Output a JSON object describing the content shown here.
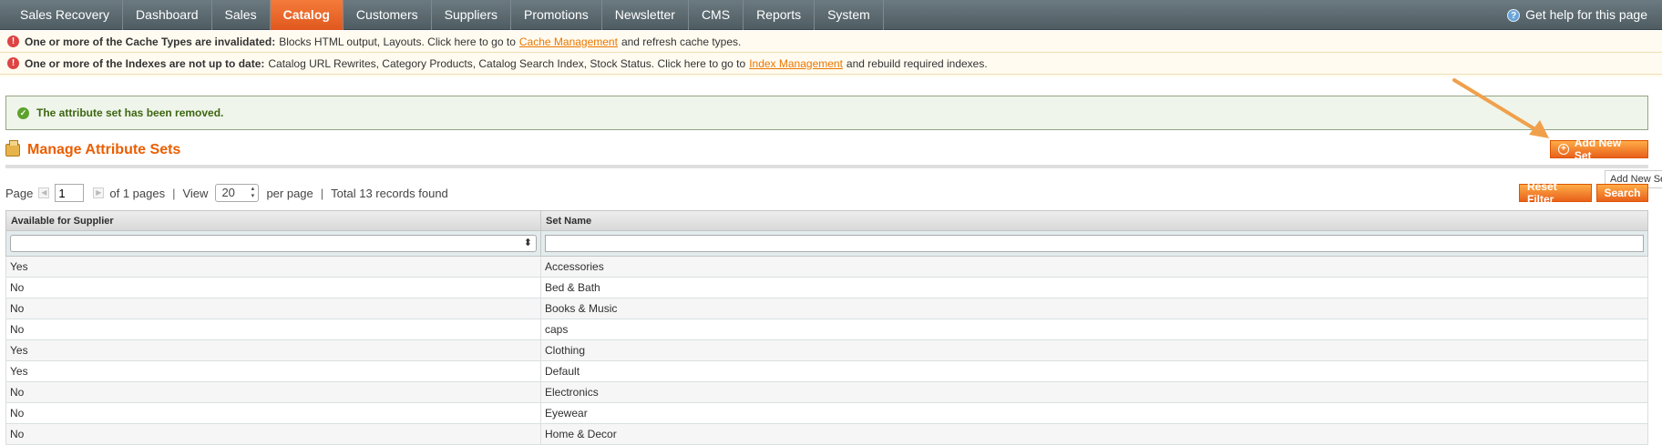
{
  "nav": {
    "items": [
      "Sales Recovery",
      "Dashboard",
      "Sales",
      "Catalog",
      "Customers",
      "Suppliers",
      "Promotions",
      "Newsletter",
      "CMS",
      "Reports",
      "System"
    ],
    "active": "Catalog",
    "help": "Get help for this page"
  },
  "notices": [
    {
      "bold": "One or more of the Cache Types are invalidated:",
      "text": "Blocks HTML output, Layouts. Click here to go to",
      "link": "Cache Management",
      "tail": "and refresh cache types."
    },
    {
      "bold": "One or more of the Indexes are not up to date:",
      "text": "Catalog URL Rewrites, Category Products, Catalog Search Index, Stock Status. Click here to go to",
      "link": "Index Management",
      "tail": "and rebuild required indexes."
    }
  ],
  "success": "The attribute set has been removed.",
  "page": {
    "title": "Manage Attribute Sets",
    "add_button": "Add New Set",
    "tooltip": "Add New Set",
    "reset_button": "Reset Filter",
    "search_button": "Search"
  },
  "pager": {
    "page_label": "Page",
    "page_value": "1",
    "of_pages": "of 1 pages",
    "view_label": "View",
    "per_page_value": "20",
    "per_page_label": "per page",
    "total": "Total 13 records found"
  },
  "grid": {
    "columns": [
      "Available for Supplier",
      "Set Name"
    ],
    "rows": [
      [
        "Yes",
        "Accessories"
      ],
      [
        "No",
        "Bed & Bath"
      ],
      [
        "No",
        "Books & Music"
      ],
      [
        "No",
        "caps"
      ],
      [
        "Yes",
        "Clothing"
      ],
      [
        "Yes",
        "Default"
      ],
      [
        "No",
        "Electronics"
      ],
      [
        "No",
        "Eyewear"
      ],
      [
        "No",
        "Home & Decor"
      ]
    ]
  },
  "colors": {
    "accent": "#eb5e00",
    "button": "#f47b3a",
    "arrow": "#f0a04b"
  }
}
